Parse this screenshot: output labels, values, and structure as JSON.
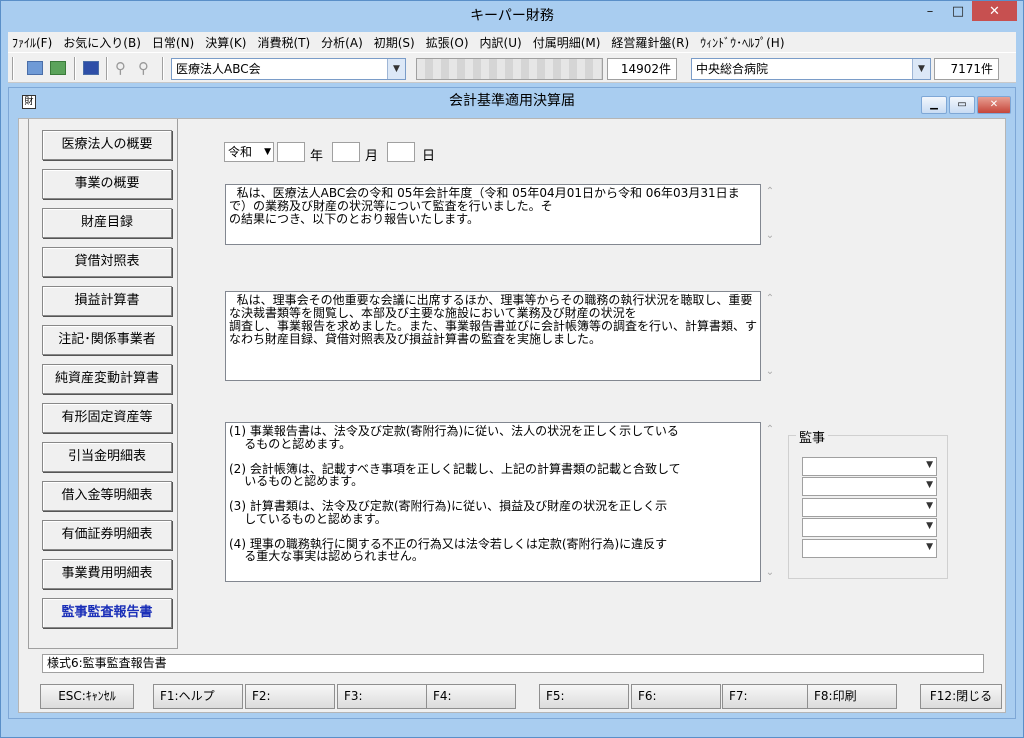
{
  "app": {
    "title": "キーパー財務",
    "controls": {
      "minimize": "–",
      "maximize": "□",
      "close": "✕"
    }
  },
  "menu": [
    "ﾌｧｲﾙ(F)",
    "お気に入り(B)",
    "日常(N)",
    "決算(K)",
    "消費税(T)",
    "分析(A)",
    "初期(S)",
    "拡張(O)",
    "内訳(U)",
    "付属明細(M)",
    "経営羅針盤(R)",
    "ｳｨﾝﾄﾞｳ･ﾍﾙﾌﾟ(H)"
  ],
  "toolbar": {
    "corp_combo": "医療法人ABC会",
    "count1": "14902件",
    "hospital_combo": "中央総合病院",
    "count2": "7171件"
  },
  "form": {
    "title": "会計基準適用決算届",
    "app_icon": "財",
    "controls": {
      "minimize": "▁",
      "maximize": "▭",
      "close": "✕"
    }
  },
  "sidebar": [
    "医療法人の概要",
    "事業の概要",
    "財産目録",
    "貸借対照表",
    "損益計算書",
    "注記･関係事業者",
    "純資産変動計算書",
    "有形固定資産等",
    "引当金明細表",
    "借入金等明細表",
    "有価証券明細表",
    "事業費用明細表",
    "監事監査報告書"
  ],
  "date": {
    "era": "令和",
    "year_label": "年",
    "month_label": "月",
    "day_label": "日"
  },
  "text1": "  私は、医療法人ABC会の令和 05年会計年度（令和 05年04月01日から令和 06年03月31日まで）の業務及び財産の状況等について監査を行いました。そ\nの結果につき、以下のとおり報告いたします。",
  "text2": "  私は、理事会その他重要な会議に出席するほか、理事等からその職務の執行状況を聴取し、重要な決裁書類等を閲覧し、本部及び主要な施設において業務及び財産の状況を\n調査し、事業報告を求めました。また、事業報告書並びに会計帳簿等の調査を行い、計算書類、すなわち財産目録、貸借対照表及び損益計算書の監査を実施しました。",
  "text3": "(1) 事業報告書は、法令及び定款(寄附行為)に従い、法人の状況を正しく示している\n    るものと認めます。\n\n(2) 会計帳簿は、記載すべき事項を正しく記載し、上記の計算書類の記載と合致して\n    いるものと認めます。\n\n(3) 計算書類は、法令及び定款(寄附行為)に従い、損益及び財産の状況を正しく示\n    しているものと認めます。\n\n(4) 理事の職務執行に関する不正の行為又は法令若しくは定款(寄附行為)に違反す\n    る重大な事実は認められません。",
  "auditor_group_label": "監事",
  "status": "様式6:監事監査報告書",
  "fkeys": [
    "ESC:ｷｬﾝｾﾙ",
    "F1:ヘルプ",
    "F2:",
    "F3:",
    "F4:",
    "F5:",
    "F6:",
    "F7:",
    "F8:印刷",
    "F12:閉じる"
  ],
  "icons": {
    "dropdown": "chevron-down-icon",
    "scroll_up": "⌃",
    "scroll_down": "⌄"
  }
}
